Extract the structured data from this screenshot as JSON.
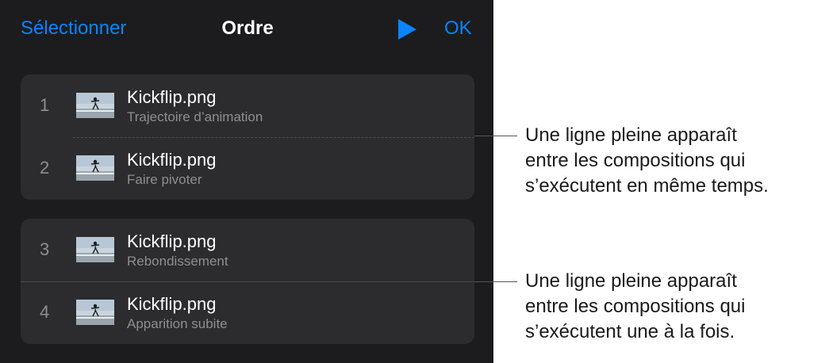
{
  "nav": {
    "select_label": "Sélectionner",
    "title": "Ordre",
    "ok_label": "OK"
  },
  "groups": [
    {
      "items": [
        {
          "number": "1",
          "title": "Kickflip.png",
          "subtitle": "Trajectoire d’animation"
        },
        {
          "number": "2",
          "title": "Kickflip.png",
          "subtitle": "Faire pivoter"
        }
      ]
    },
    {
      "items": [
        {
          "number": "3",
          "title": "Kickflip.png",
          "subtitle": "Rebondissement"
        },
        {
          "number": "4",
          "title": "Kickflip.png",
          "subtitle": "Apparition subite"
        }
      ]
    }
  ],
  "callouts": [
    {
      "lines": [
        "Une ligne pleine apparaît",
        "entre les compositions qui",
        "s’exécutent en même temps."
      ]
    },
    {
      "lines": [
        "Une ligne pleine apparaît",
        "entre les compositions qui",
        "s’exécutent une à la fois."
      ]
    }
  ],
  "colors": {
    "accent": "#0a84ff",
    "panel_bg": "#1c1c1e",
    "group_bg": "#2c2c2e",
    "secondary_text": "#8e8e93"
  }
}
